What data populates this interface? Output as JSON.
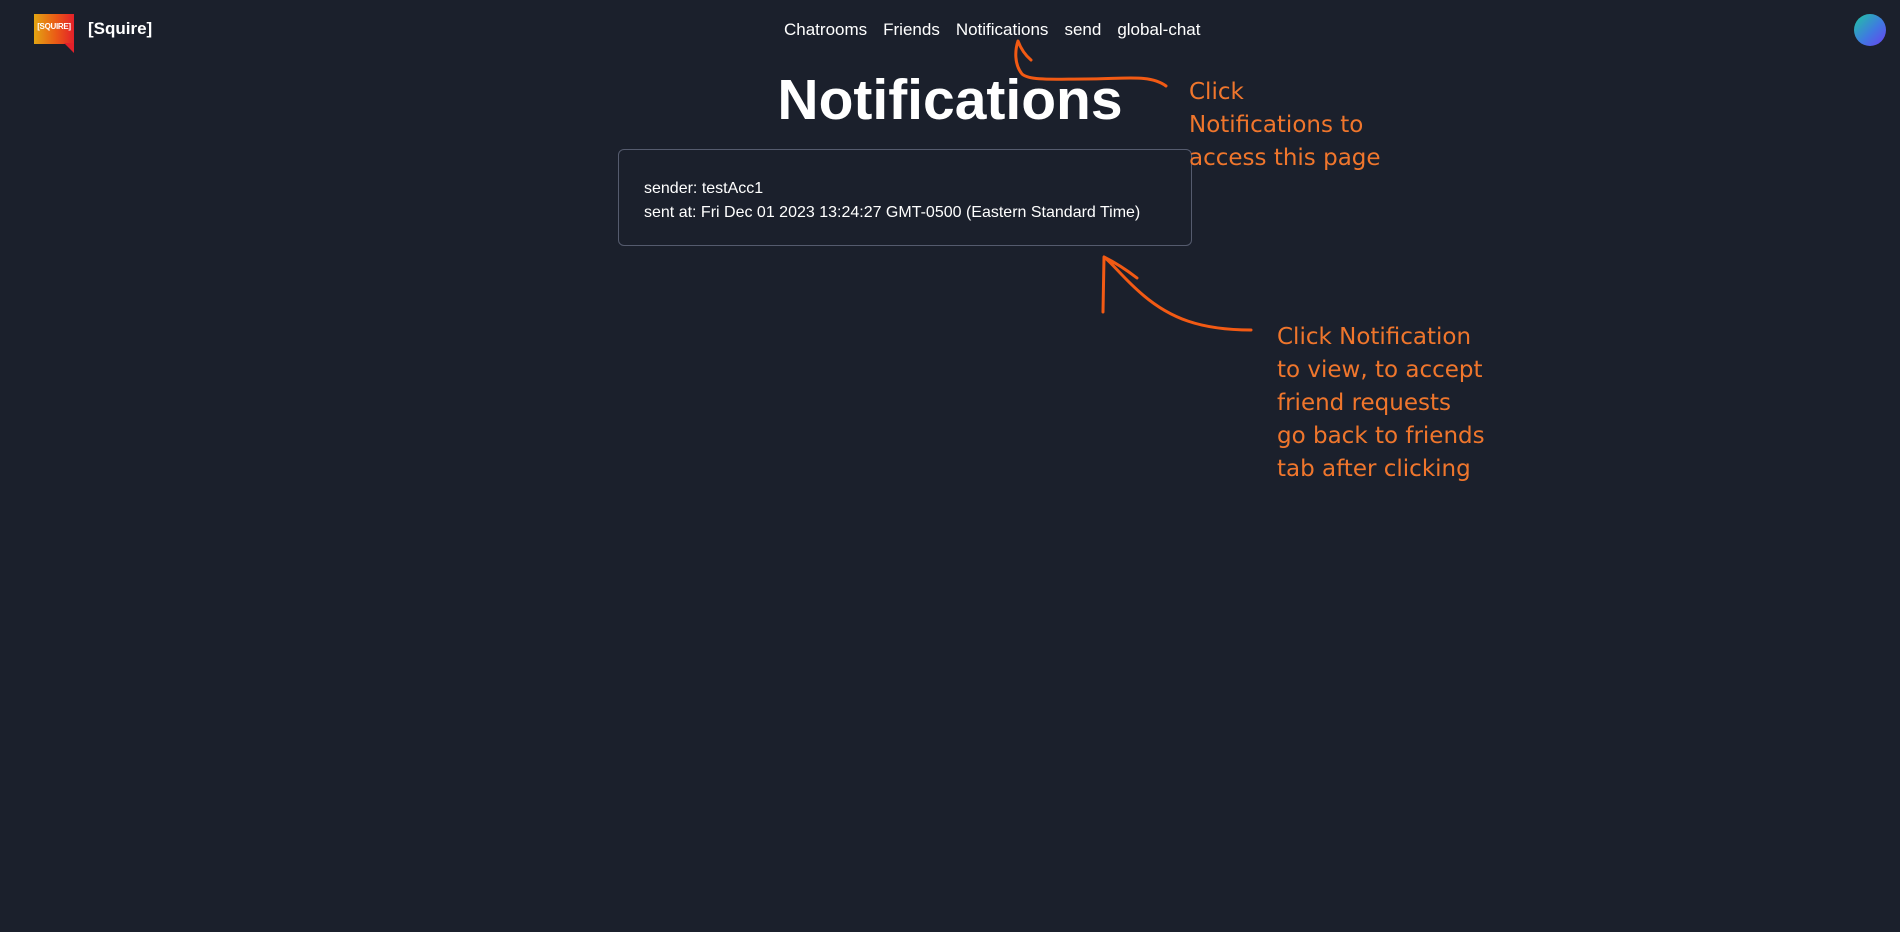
{
  "brand": {
    "logo_text": "[SQUIRE]",
    "name": "[Squire]"
  },
  "nav": {
    "items": [
      {
        "label": "Chatrooms"
      },
      {
        "label": "Friends"
      },
      {
        "label": "Notifications"
      },
      {
        "label": "send"
      },
      {
        "label": "global-chat"
      }
    ]
  },
  "page": {
    "title": "Notifications"
  },
  "notifications": [
    {
      "sender_label": "sender: testAcc1",
      "sent_at_label": "sent at: Fri Dec 01 2023 13:24:27 GMT-0500 (Eastern Standard Time)"
    }
  ],
  "annotations": {
    "color": "#f0762c",
    "note_1": {
      "lines": [
        "Click",
        "Notifications to",
        "access this page"
      ]
    },
    "note_2": {
      "lines": [
        "Click Notification",
        "to view, to accept",
        "friend requests",
        "go back to friends",
        "tab after clicking"
      ]
    }
  },
  "colors": {
    "background": "#1b202c",
    "card_border": "#555b6e",
    "text": "#ffffff"
  }
}
